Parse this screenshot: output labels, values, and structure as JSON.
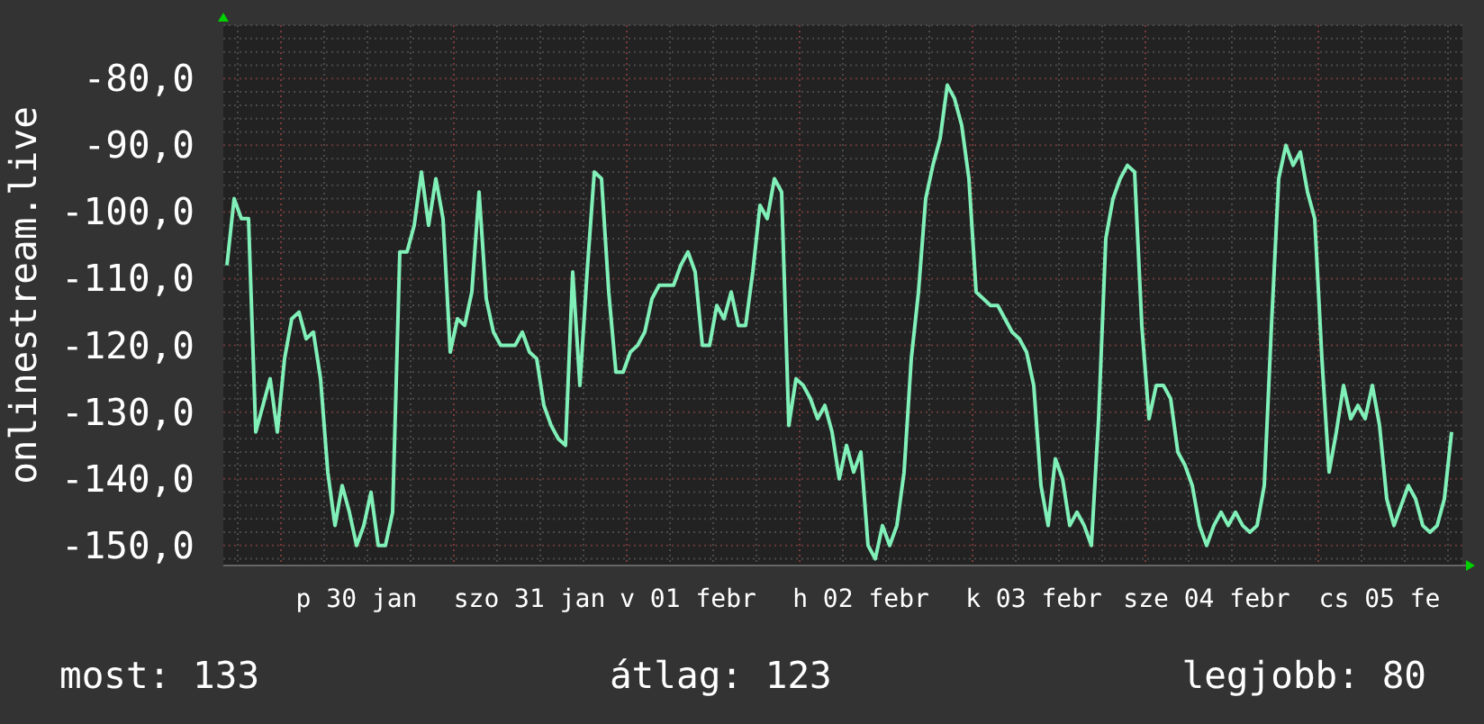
{
  "chart": {
    "chart_data": {
      "type": "line",
      "ylabel": "onlinestream.live",
      "grid": true,
      "ylim": [
        -153,
        -72
      ],
      "categories": [
        null,
        null,
        null,
        null,
        null,
        null,
        null,
        null,
        null,
        null,
        null,
        null,
        null,
        null,
        null,
        null,
        null,
        null,
        "p 30 jan",
        null,
        null,
        null,
        null,
        null,
        null,
        null,
        null,
        null,
        null,
        null,
        null,
        null,
        null,
        null,
        null,
        null,
        null,
        null,
        null,
        null,
        null,
        null,
        "szo 31 jan",
        null,
        null,
        null,
        null,
        null,
        null,
        null,
        null,
        null,
        null,
        null,
        null,
        null,
        null,
        null,
        null,
        null,
        null,
        null,
        null,
        null,
        "v 01 febr",
        null,
        null,
        null,
        null,
        null,
        null,
        null,
        null,
        null,
        null,
        null,
        null,
        null,
        null,
        null,
        null,
        null,
        null,
        null,
        null,
        null,
        null,
        null,
        "h 02 febr",
        null,
        null,
        null,
        null,
        null,
        null,
        null,
        null,
        null,
        null,
        null,
        null,
        null,
        null,
        null,
        null,
        null,
        null,
        null,
        null,
        null,
        null,
        null,
        "k 03 febr",
        null,
        null,
        null,
        null,
        null,
        null,
        null,
        null,
        null,
        null,
        null,
        null,
        null,
        null,
        null,
        null,
        null,
        null,
        null,
        null,
        null,
        null,
        null,
        "sze 04 febr",
        null,
        null,
        null,
        null,
        null,
        null,
        null,
        null,
        null,
        null,
        null,
        null,
        null,
        null,
        null,
        null,
        null,
        null,
        null,
        null,
        null,
        null,
        null,
        "cs 05 fe",
        null,
        null,
        null,
        null,
        null,
        null,
        null,
        null,
        null,
        null
      ],
      "yticks": [
        {
          "value": -80,
          "label": "-80,0"
        },
        {
          "value": -90,
          "label": "-90,0"
        },
        {
          "value": -100,
          "label": "-100,0"
        },
        {
          "value": -110,
          "label": "-110,0"
        },
        {
          "value": -120,
          "label": "-120,0"
        },
        {
          "value": -130,
          "label": "-130,0"
        },
        {
          "value": -140,
          "label": "-140,0"
        },
        {
          "value": -150,
          "label": "-150,0"
        }
      ],
      "series": [
        {
          "color": "#80f0b8",
          "values": [
            -108,
            -98,
            -101,
            -101,
            -133,
            -129,
            -125,
            -133,
            -122,
            -116,
            -115,
            -119,
            -118,
            -125,
            -139,
            -147,
            -141,
            -145,
            -150,
            -147,
            -142,
            -150,
            -150,
            -145,
            -106,
            -106,
            -102,
            -94,
            -102,
            -95,
            -101,
            -121,
            -116,
            -117,
            -112,
            -97,
            -113,
            -118,
            -120,
            -120,
            -120,
            -118,
            -121,
            -122,
            -129,
            -132,
            -134,
            -135,
            -109,
            -126,
            -109,
            -94,
            -95,
            -112,
            -124,
            -124,
            -121,
            -120,
            -118,
            -113,
            -111,
            -111,
            -111,
            -108,
            -106,
            -109,
            -120,
            -120,
            -114,
            -116,
            -112,
            -117,
            -117,
            -109,
            -99,
            -101,
            -95,
            -97,
            -132,
            -125,
            -126,
            -128,
            -131,
            -129,
            -133,
            -140,
            -135,
            -139,
            -136,
            -150,
            -152,
            -147,
            -150,
            -147,
            -139,
            -122,
            -112,
            -98,
            -93,
            -89,
            -81,
            -83,
            -87,
            -95,
            -112,
            -113,
            -114,
            -114,
            -116,
            -118,
            -119,
            -121,
            -126,
            -141,
            -147,
            -137,
            -140,
            -147,
            -145,
            -147,
            -150,
            -131,
            -104,
            -98,
            -95,
            -93,
            -94,
            -117,
            -131,
            -126,
            -126,
            -128,
            -136,
            -138,
            -141,
            -147,
            -150,
            -147,
            -145,
            -147,
            -145,
            -147,
            -148,
            -147,
            -141,
            -117,
            -95,
            -90,
            -93,
            -91,
            -97,
            -101,
            -122,
            -139,
            -133,
            -126,
            -131,
            -129,
            -131,
            -126,
            -132,
            -143,
            -147,
            -144,
            -141,
            -143,
            -147,
            -148,
            -147,
            -143,
            -133
          ]
        }
      ]
    }
  },
  "legend": [
    "most: 133",
    "átlag: 123",
    "legjobb: 80"
  ]
}
